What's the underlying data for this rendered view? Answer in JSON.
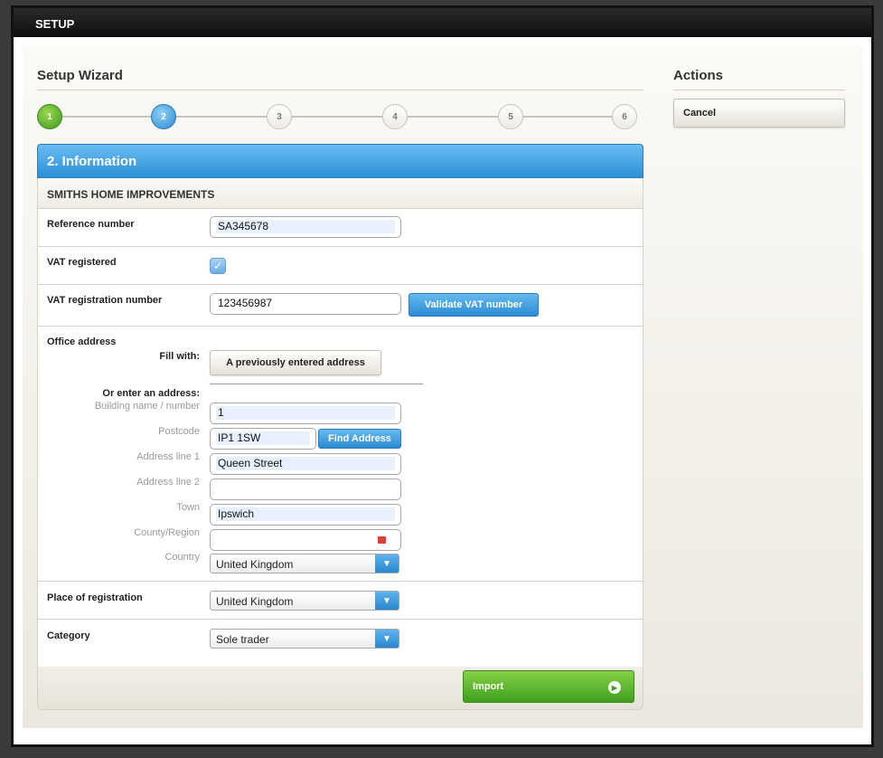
{
  "window": {
    "title": "SETUP"
  },
  "wizard": {
    "title": "Setup Wizard",
    "steps": [
      "1",
      "2",
      "3",
      "4",
      "5",
      "6"
    ],
    "current_step": 2
  },
  "actions": {
    "title": "Actions",
    "cancel_label": "Cancel"
  },
  "section": {
    "title": "2. Information",
    "company": "SMITHS HOME IMPROVEMENTS"
  },
  "form": {
    "reference": {
      "label": "Reference number",
      "value": "SA345678"
    },
    "vat_registered": {
      "label": "VAT registered",
      "checked": true
    },
    "vat_number": {
      "label": "VAT registration number",
      "value": "123456987",
      "validate_label": "Validate VAT number"
    },
    "office_address": {
      "label": "Office address",
      "fill_with_label": "Fill with:",
      "fill_button_label": "A previously entered address",
      "or_enter_label": "Or enter an address:",
      "building": {
        "label": "Building name / number",
        "value": "1"
      },
      "postcode": {
        "label": "Postcode",
        "value": "IP1 1SW",
        "find_label": "Find Address"
      },
      "line1": {
        "label": "Address line 1",
        "value": "Queen Street"
      },
      "line2": {
        "label": "Address line 2",
        "value": ""
      },
      "town": {
        "label": "Town",
        "value": "Ipswich"
      },
      "county": {
        "label": "County/Region",
        "value": ""
      },
      "country": {
        "label": "Country",
        "value": "United Kingdom"
      }
    },
    "place_of_registration": {
      "label": "Place of registration",
      "value": "United Kingdom"
    },
    "category": {
      "label": "Category",
      "value": "Sole trader"
    }
  },
  "footer": {
    "import_label": "Import"
  },
  "colors": {
    "accent_blue": "#2c90d7",
    "success_green": "#3ea01e",
    "step_done": "#3f9a20",
    "step_current": "#2a89cf"
  }
}
